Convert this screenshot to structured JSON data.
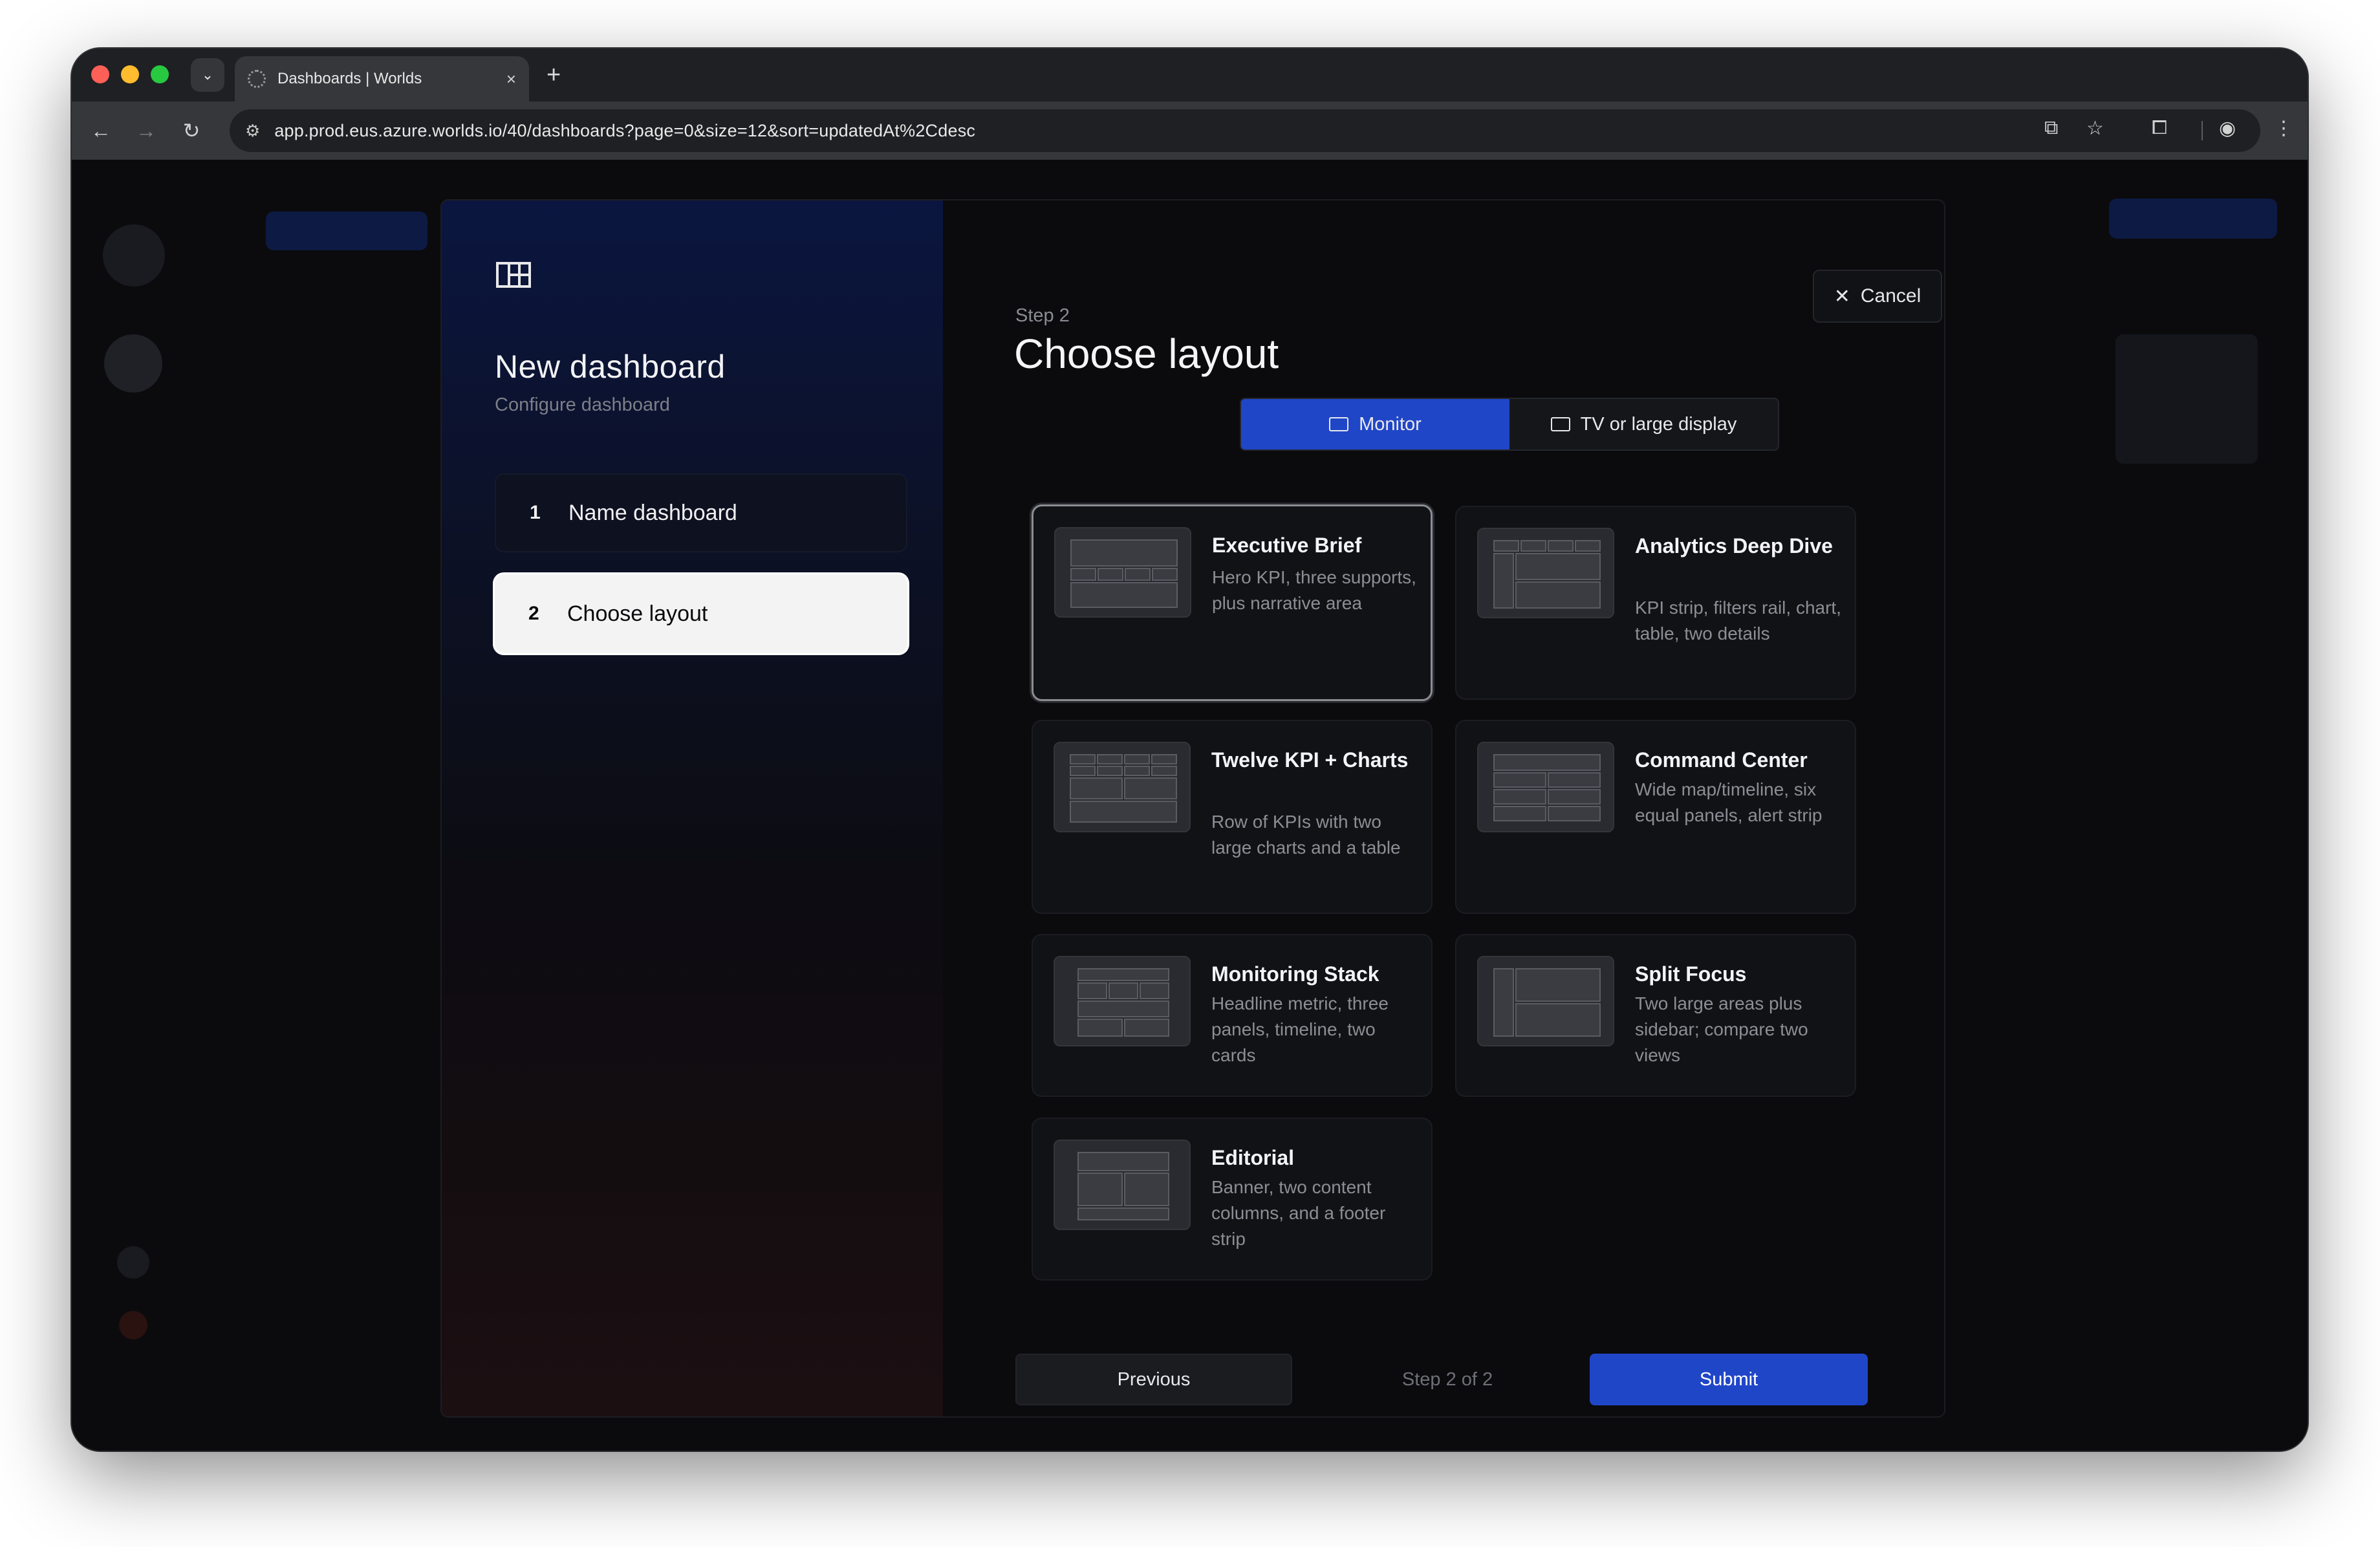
{
  "browser": {
    "tab_title": "Dashboards | Worlds",
    "tab_close": "×",
    "new_tab": "+",
    "url": "app.prod.eus.azure.worlds.io/40/dashboards?page=0&size=12&sort=updatedAt%2Cdesc"
  },
  "wizard": {
    "title": "New dashboard",
    "subtitle": "Configure dashboard",
    "steps": [
      {
        "number": "1",
        "label": "Name dashboard"
      },
      {
        "number": "2",
        "label": "Choose layout"
      }
    ]
  },
  "content": {
    "step_label": "Step 2",
    "title": "Choose layout",
    "cancel_label": "Cancel",
    "display_toggle": {
      "options": [
        "Monitor",
        "TV or large display"
      ],
      "selected": "Monitor"
    },
    "layouts": [
      {
        "title": "Executive Brief",
        "description": "Hero KPI, three supports, plus narrative area",
        "selected": true
      },
      {
        "title": "Analytics Deep Dive",
        "description": "KPI strip, filters rail, chart, table, two details",
        "selected": false
      },
      {
        "title": "Twelve KPI + Charts",
        "description": "Row of KPIs with two large charts and a table",
        "selected": false
      },
      {
        "title": "Command Center",
        "description": "Wide map/timeline, six equal panels, alert strip",
        "selected": false
      },
      {
        "title": "Monitoring Stack",
        "description": "Headline metric, three panels, timeline, two cards",
        "selected": false
      },
      {
        "title": "Split Focus",
        "description": "Two large areas plus sidebar; compare two views",
        "selected": false
      },
      {
        "title": "Editorial",
        "description": "Banner, two content columns, and a footer strip",
        "selected": false
      }
    ],
    "previous_label": "Previous",
    "step_counter": "Step 2 of 2",
    "submit_label": "Submit"
  },
  "colors": {
    "accent": "#2046c8",
    "background": "#0b0b0d"
  }
}
